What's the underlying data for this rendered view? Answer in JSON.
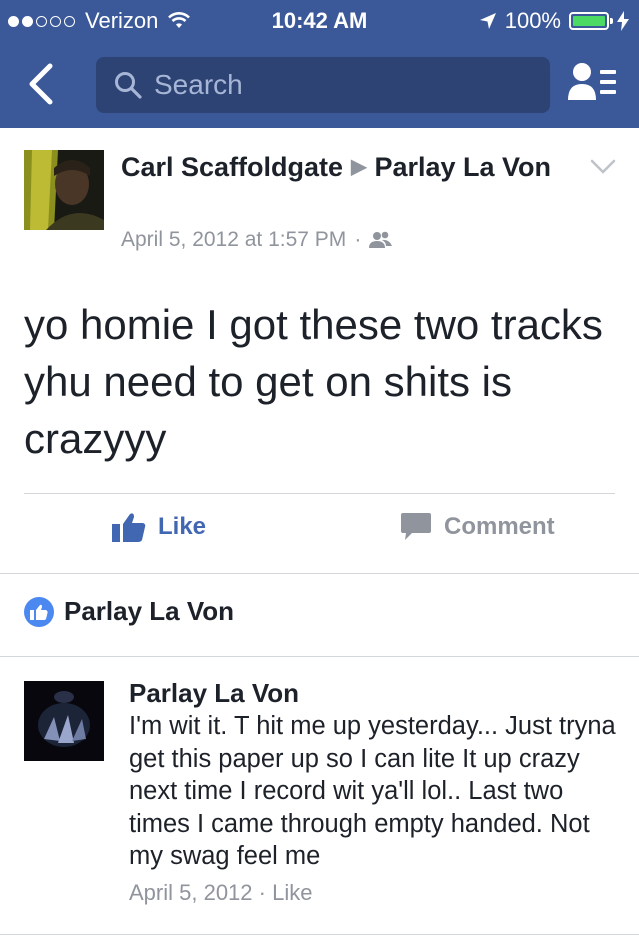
{
  "status_bar": {
    "carrier": "Verizon",
    "time": "10:42 AM",
    "battery": "100%",
    "signal_bars_filled": 2,
    "signal_bars_total": 5
  },
  "nav": {
    "search_placeholder": "Search",
    "icons": [
      "back-chevron-icon",
      "search-icon",
      "friend-requests-icon"
    ]
  },
  "post": {
    "author": "Carl Scaffoldgate",
    "target": "Parlay La Von",
    "timestamp": "April 5, 2012 at 1:57 PM",
    "separator": "·",
    "body": "yo homie I got these two tracks yhu need to get on shits is crazyyy",
    "like_label": "Like",
    "comment_label": "Comment"
  },
  "likes": {
    "names": "Parlay La Von"
  },
  "comment": {
    "author": "Parlay La Von",
    "text": "I'm wit it. T hit me up yesterday... Just tryna get this paper up so I can lite It up crazy next time I record wit ya'll lol.. Last two times I came through empty handed. Not my swag feel me",
    "date": "April 5, 2012",
    "separator": "·",
    "like_label": "Like"
  },
  "colors": {
    "brand_blue": "#3b5998",
    "search_bg": "#2d4373",
    "like_blue": "#4267b2",
    "meta_gray": "#90949c",
    "battery_green": "#4cd964"
  }
}
